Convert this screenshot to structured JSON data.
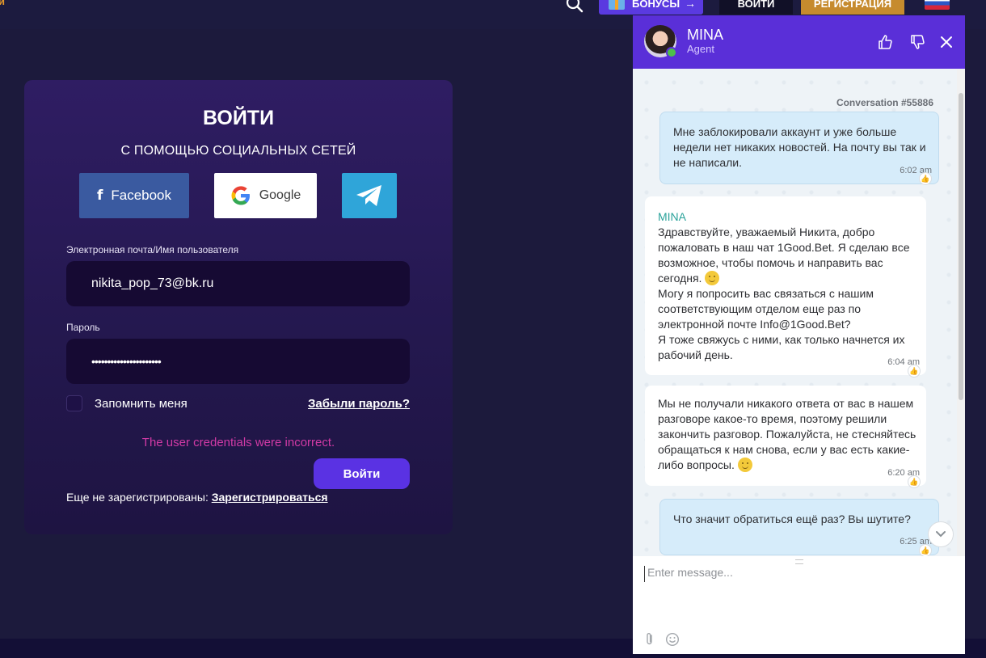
{
  "topnav": {
    "edge_text": "и",
    "bonus_label": "БОНУСЫ",
    "bonus_arrow": "→",
    "login_label": "ВОЙТИ",
    "register_label": "РЕГИСТРАЦИЯ"
  },
  "login": {
    "title": "ВОЙТИ",
    "subtitle": "С ПОМОЩЬЮ СОЦИАЛЬНЫХ СЕТЕЙ",
    "facebook_label": "Facebook",
    "google_label": "Google",
    "email_label": "Электронная почта/Имя пользователя",
    "email_value": "nikita_pop_73@bk.ru",
    "password_label": "Пароль",
    "password_value": "••••••••••••••••••••••",
    "remember_label": "Запомнить меня",
    "forgot_label": "Забыли пароль?",
    "error_text": "The user credentials were incorrect.",
    "submit_label": "Войти",
    "noreg_text": "Еще не зарегистрированы: ",
    "register_link": "Зарегистрироваться"
  },
  "chat": {
    "agent_name": "MINA",
    "agent_role": "Agent",
    "conversation_id": "Conversation #55886",
    "messages": [
      {
        "from": "user",
        "text": "Мне заблокировали аккаунт и уже больше недели нет никаких новостей. На почту вы так и не написали.",
        "time": "6:02 am"
      },
      {
        "from": "agent",
        "sender": "MINA",
        "line1": "Здравствуйте, уважаемый Никита, добро пожаловать в наш чат 1Good.Bet. Я сделаю все возможное, чтобы помочь и направить вас сегодня.",
        "line2": "Могу я попросить вас связаться с нашим соответствующим отделом еще раз по электронной почте Info@1Good.Bet?",
        "line3": "Я тоже свяжусь с ними, как только начнется их рабочий день.",
        "time": "6:04 am"
      },
      {
        "from": "agent",
        "text": "Мы не получали никакого ответа от вас в нашем разговоре какое-то время, поэтому решили закончить разговор. Пожалуйста, не стесняйтесь обращаться к нам снова, если у вас есть какие-либо вопросы.",
        "time": "6:20 am"
      },
      {
        "from": "user",
        "text": "Что значит обратиться ещё раз? Вы шутите?",
        "time": "6:25 am"
      }
    ],
    "input_placeholder": "Enter message..."
  },
  "colors": {
    "page_bg": "#1c1a3c",
    "accent_purple": "#5a32e3",
    "error_pink": "#d23aa6",
    "register_gold": "#c68b2e",
    "chat_header": "#5a2fd8",
    "user_bubble": "#d6ecfa"
  },
  "icons": [
    "search-icon",
    "gift-icon",
    "facebook-icon",
    "google-icon",
    "telegram-icon",
    "thumbs-up-icon",
    "thumbs-down-icon",
    "close-icon",
    "chevron-down-icon",
    "paperclip-icon",
    "smile-icon",
    "emoji-icon"
  ]
}
